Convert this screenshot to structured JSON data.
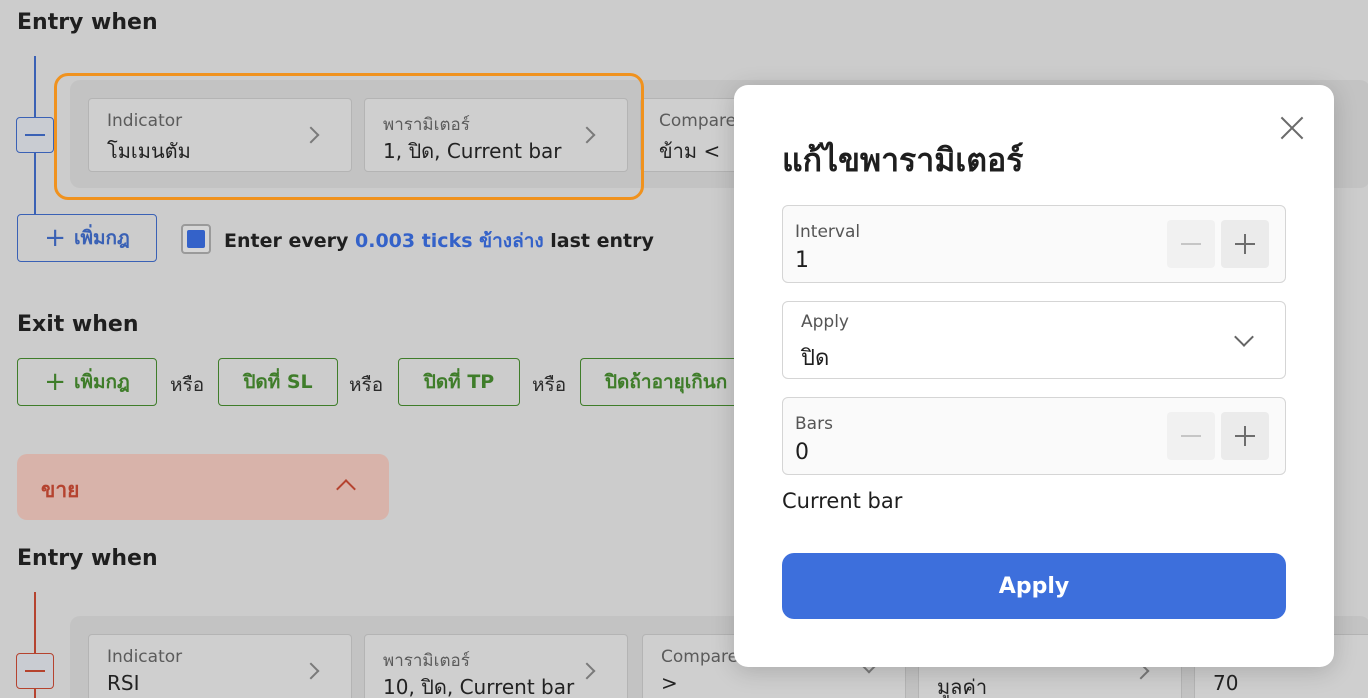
{
  "buy_section": {
    "entry_heading": "Entry when",
    "rule": {
      "indicator": {
        "label": "Indicator",
        "value": "โมเมนตัม"
      },
      "params": {
        "label": "พารามิเตอร์",
        "value": "1, ปิด, Current bar"
      },
      "compare": {
        "label": "Compare",
        "value": "ข้าม <"
      }
    },
    "add_rule_label": "เพิ่มกฎ",
    "enter_every": {
      "prefix": "Enter every",
      "ticks_link": "0.003 ticks ข้างล่าง",
      "suffix": "last entry",
      "checked": true
    },
    "exit_heading": "Exit when",
    "exit_add_rule_label": "เพิ่มกฎ",
    "or_label": "หรือ",
    "exit_sl": "ปิดที่ SL",
    "exit_tp": "ปิดที่ TP",
    "exit_age": "ปิดถ้าอายุเกินก"
  },
  "sell_section": {
    "title": "ขาย",
    "entry_heading": "Entry when",
    "rule": {
      "indicator": {
        "label": "Indicator",
        "value": "RSI"
      },
      "params": {
        "label": "พารามิเตอร์",
        "value": "10, ปิด, Current bar"
      },
      "compare": {
        "label": "Compare",
        "value": ">"
      },
      "value_type": {
        "label": "",
        "value": "มูลค่า"
      },
      "number": {
        "label": "",
        "value": "70"
      }
    }
  },
  "modal": {
    "title": "แก้ไขพารามิเตอร์",
    "interval": {
      "label": "Interval",
      "value": "1"
    },
    "apply_field": {
      "label": "Apply",
      "value": "ปิด"
    },
    "bars": {
      "label": "Bars",
      "value": "0"
    },
    "current_bar_text": "Current bar",
    "apply_button": "Apply"
  },
  "colors": {
    "accent_blue": "#3d6fdc",
    "highlight_orange": "#f0921e",
    "exit_green": "#3f7d2a",
    "sell_red": "#b5432f"
  }
}
